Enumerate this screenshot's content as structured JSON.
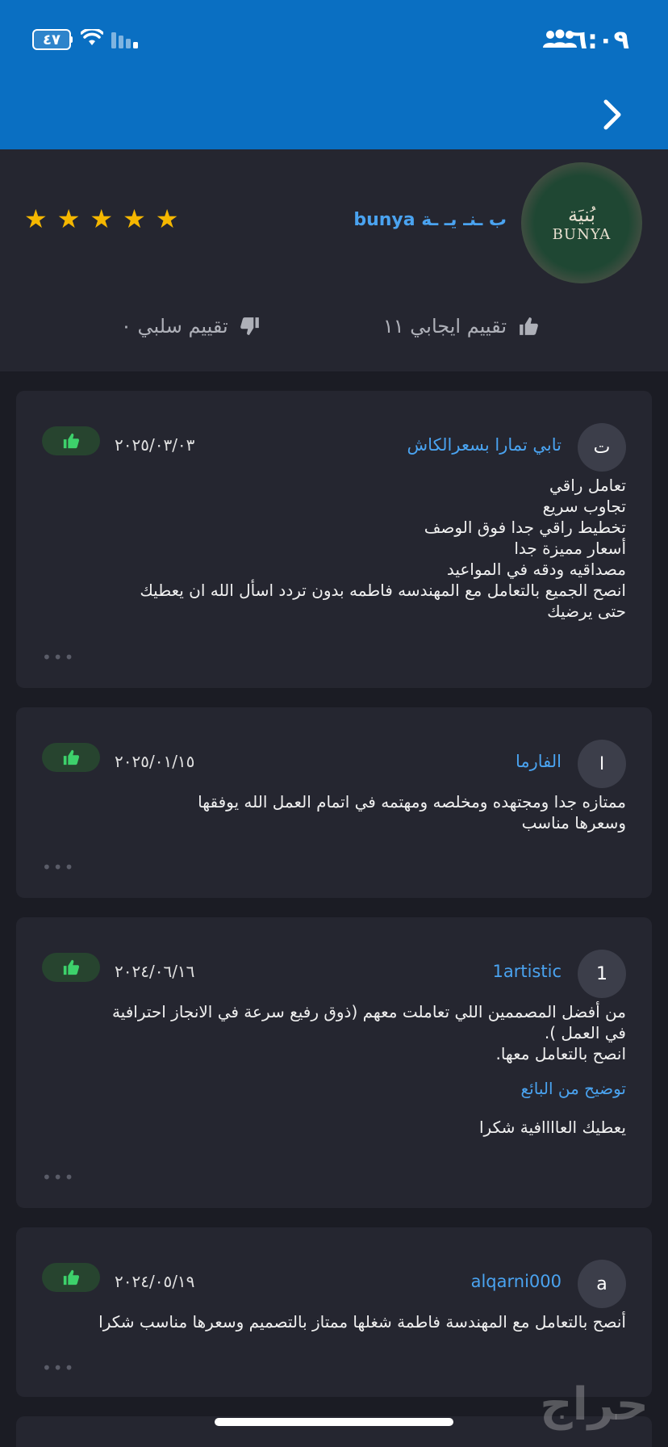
{
  "status_bar": {
    "time": "٦:٠٩",
    "battery": "٤٧"
  },
  "seller": {
    "name": "ب ـنـ يـ ـة bunya",
    "logo_text": "BUNYA",
    "logo_arabic": "بُنيَة",
    "rating_stars": 5,
    "positive_label": "تقييم ايجابي ١١",
    "negative_label": "تقييم سلبي ٠"
  },
  "reviews": [
    {
      "avatar_letter": "ت",
      "user": "تابي تمارا بسعرالكاش",
      "date": "٢٠٢٥/٠٣/٠٣",
      "text": "تعامل راقي\nتجاوب سريع\nتخطيط راقي جدا فوق الوصف\nأسعار مميزة جدا\nمصداقيه ودقه في المواعيد\nانصح الجميع بالتعامل مع المهندسه فاطمه بدون تردد اسأل الله ان يعطيك\nحتى يرضيك"
    },
    {
      "avatar_letter": "ا",
      "user": "الفارما",
      "date": "٢٠٢٥/٠١/١٥",
      "text": "ممتازه جدا ومجتهده ومخلصه ومهتمه في اتمام العمل الله يوفقها\nوسعرها مناسب"
    },
    {
      "avatar_letter": "1",
      "user": "1artistic",
      "date": "٢٠٢٤/٠٦/١٦",
      "text": "من أفضل المصممين اللي تعاملت معهم (ذوق رفيع   سرعة في الانجاز   احترافية\nفي العمل ).\nانصح بالتعامل معها.",
      "reply_label": "توضيح من البائع",
      "reply_text": "يعطيك العاااافية شكرا"
    },
    {
      "avatar_letter": "a",
      "user": "alqarni000",
      "date": "٢٠٢٤/٠٥/١٩",
      "text": "أنصح بالتعامل مع المهندسة فاطمة شغلها ممتاز بالتصميم وسعرها مناسب شكرا"
    }
  ],
  "more_label": "•••",
  "watermark": "حراج",
  "colors": {
    "header": "#0a6fc2",
    "accent": "#4aa3f0",
    "star": "#f5b700",
    "like": "#3dd16b"
  }
}
